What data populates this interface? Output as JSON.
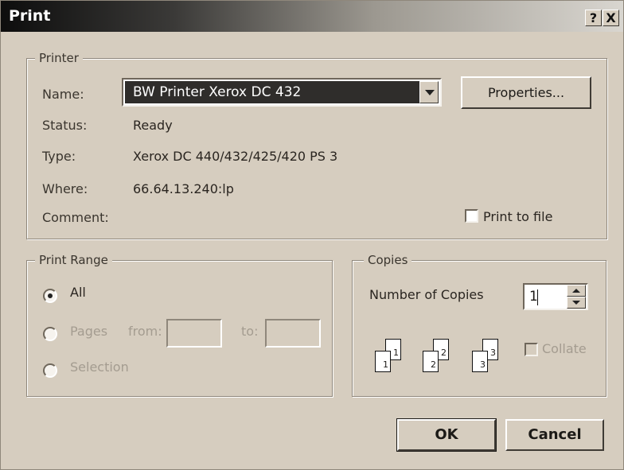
{
  "window": {
    "title": "Print",
    "help_btn": "?",
    "close_btn": "X"
  },
  "printer": {
    "group_label": "Printer",
    "name_label": "Name:",
    "name_value": "BW Printer Xerox DC 432",
    "properties_btn": "Properties...",
    "status_label": "Status:",
    "status_value": "Ready",
    "type_label": "Type:",
    "type_value": "Xerox DC 440/432/425/420 PS 3",
    "where_label": "Where:",
    "where_value": "66.64.13.240:lp",
    "comment_label": "Comment:",
    "print_to_file_label": "Print to file",
    "print_to_file_checked": false
  },
  "range": {
    "group_label": "Print Range",
    "all_label": "All",
    "pages_label": "Pages",
    "from_label": "from:",
    "to_label": "to:",
    "selection_label": "Selection",
    "selected": "All"
  },
  "copies": {
    "group_label": "Copies",
    "number_label": "Number of Copies",
    "number_value": "1",
    "collate_label": "Collate",
    "collate_checked": false,
    "page_numbers": [
      "1",
      "1",
      "2",
      "2",
      "3",
      "3"
    ]
  },
  "buttons": {
    "ok": "OK",
    "cancel": "Cancel"
  }
}
